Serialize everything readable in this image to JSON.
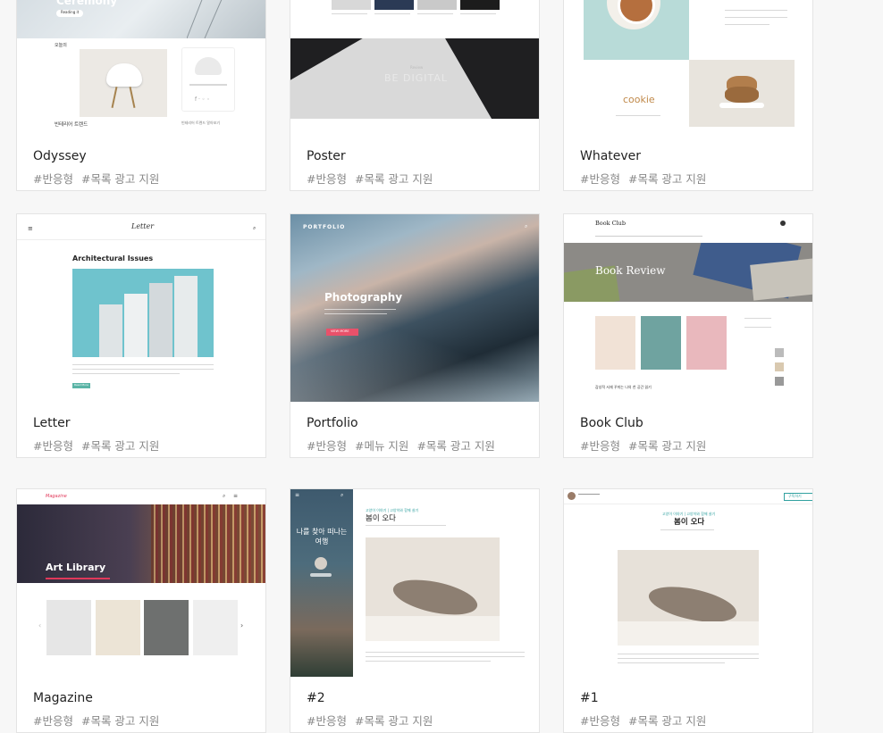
{
  "cards": [
    {
      "name": "Odyssey",
      "tags": [
        "#반응형",
        "#목록 광고 지원"
      ],
      "preview": {
        "hero": "Ceremony",
        "cta": "Reading it",
        "section_tag": "오늘의",
        "caption": "빈테리어 트렌드",
        "side_caption": "빈테리어 트렌드 알아보기"
      }
    },
    {
      "name": "Poster",
      "tags": [
        "#반응형",
        "#목록 광고 지원"
      ],
      "preview": {
        "banner": "BE DIGITAL",
        "banner_tag": "Review"
      }
    },
    {
      "name": "Whatever",
      "tags": [
        "#반응형",
        "#목록 광고 지원"
      ],
      "preview": {
        "title": "cookie"
      }
    },
    {
      "name": "Letter",
      "tags": [
        "#반응형",
        "#목록 광고 지원"
      ],
      "preview": {
        "logo": "Letter",
        "article": "Architectural Issues",
        "button": "Read More"
      }
    },
    {
      "name": "Portfolio",
      "tags": [
        "#반응형",
        "#메뉴 지원",
        "#목록 광고 지원"
      ],
      "preview": {
        "logo": "PORTFOLIO",
        "title": "Photography",
        "button": "VIEW MORE"
      }
    },
    {
      "name": "Book Club",
      "tags": [
        "#반응형",
        "#목록 광고 지원"
      ],
      "preview": {
        "logo": "Book Club",
        "banner": "Book Review",
        "caption": "감성적 서재 꾸미는 나의 찬 공간 읽기"
      }
    },
    {
      "name": "Magazine",
      "tags": [
        "#반응형",
        "#목록 광고 지원"
      ],
      "preview": {
        "logo": "Magazine",
        "banner": "Art Library"
      }
    },
    {
      "name": "#2",
      "tags": [
        "#반응형",
        "#목록 광고 지원"
      ],
      "preview": {
        "side_title": "나를 찾아 떠나는 여행",
        "category": "고양이 이야기 | 고양이와 함께 살기",
        "title": "봄이 오다"
      }
    },
    {
      "name": "#1",
      "tags": [
        "#반응형",
        "#목록 광고 지원"
      ],
      "preview": {
        "category": "고양이 이야기 | 고양이와 함께 살기",
        "title": "봄이 오다",
        "button": "구독하기"
      }
    }
  ]
}
